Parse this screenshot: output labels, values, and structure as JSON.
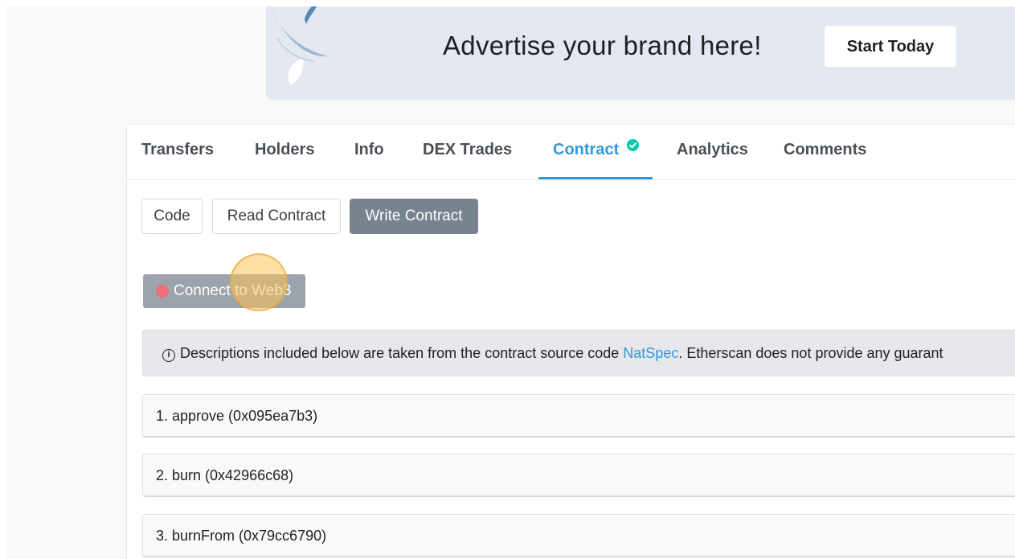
{
  "ad": {
    "headline": "Advertise your brand here!",
    "cta_label": "Start Today"
  },
  "tabs": [
    {
      "label": "Transfers",
      "active": false
    },
    {
      "label": "Holders",
      "active": false
    },
    {
      "label": "Info",
      "active": false
    },
    {
      "label": "DEX Trades",
      "active": false
    },
    {
      "label": "Contract",
      "active": true,
      "verified": true
    },
    {
      "label": "Analytics",
      "active": false
    },
    {
      "label": "Comments",
      "active": false
    }
  ],
  "contract_nav": {
    "code_label": "Code",
    "read_label": "Read Contract",
    "write_label": "Write Contract",
    "active": "Write Contract"
  },
  "connect": {
    "label": "Connect to Web3",
    "status_color": "#ec6f7a"
  },
  "info": {
    "prefix": "Descriptions included below are taken from the contract source code ",
    "link_text": "NatSpec",
    "suffix": ". Etherscan does not provide any guarant"
  },
  "functions": [
    {
      "label": "1. approve (0x095ea7b3)"
    },
    {
      "label": "2. burn (0x42966c68)"
    },
    {
      "label": "3. burnFrom (0x79cc6790)"
    }
  ],
  "colors": {
    "accent": "#3498db",
    "verified": "#00c9a7",
    "button_dark": "#77838f"
  }
}
